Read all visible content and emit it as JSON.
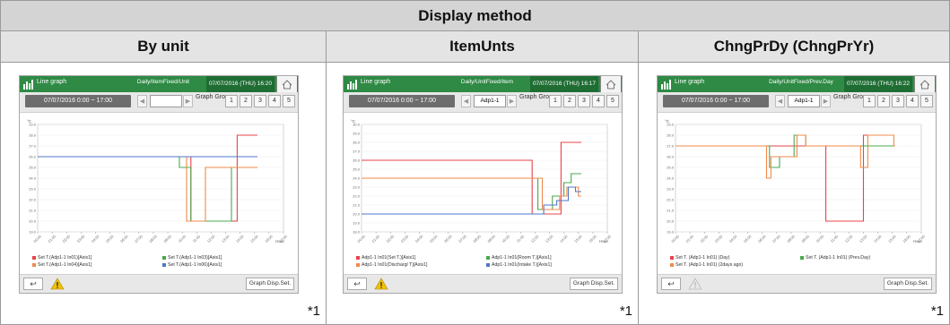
{
  "table_title": "Display method",
  "columns": [
    {
      "header": "By unit",
      "footnote": "*1",
      "screen": {
        "app_title": "Line graph",
        "mode": "Daily/ItemFixed/Unit",
        "datetime": "07/07/2016 (THU) 16:20",
        "range": "07/07/2016 0:00 ~ 17:00",
        "selected_unit": "",
        "graph_group_label": "Graph Group",
        "groups": [
          "1",
          "2",
          "3",
          "4",
          "5"
        ],
        "graph_disp_set": "Graph Disp.Set.",
        "warning_active": true,
        "legend": [
          {
            "label": "Set T.(Adp1-1 In01)[Axis1]",
            "color": "#e8434a"
          },
          {
            "label": "Set T.(Adp1-1 In03)[Axis1]",
            "color": "#4aa84e"
          },
          {
            "label": "Set T.(Adp1-1 In04)[Axis1]",
            "color": "#f08a4b"
          },
          {
            "label": "Set T.(Adp1-1 In06)[Axis1]",
            "color": "#4f77c7"
          }
        ]
      }
    },
    {
      "header": "ItemUnts",
      "footnote": "*1",
      "screen": {
        "app_title": "Line graph",
        "mode": "Daily/UnitFixed/Item",
        "datetime": "07/07/2016 (THU) 16:17",
        "range": "07/07/2016 0:00 ~ 17:00",
        "selected_unit": "Adp1-1",
        "graph_group_label": "Graph Group",
        "groups": [
          "1",
          "2",
          "3",
          "4",
          "5"
        ],
        "graph_disp_set": "Graph Disp.Set.",
        "warning_active": true,
        "legend": [
          {
            "label": "Adp1-1 In01(Set T.)[Axis1]",
            "color": "#e8434a"
          },
          {
            "label": "Adp1-1 In01(Room T.)[Axis1]",
            "color": "#4aa84e"
          },
          {
            "label": "Adp1-1 In01(Dischargl T)[Axis1]",
            "color": "#f08a4b"
          },
          {
            "label": "Adp1-1 In01(Intake T.)[Axis1]",
            "color": "#4f77c7"
          }
        ]
      }
    },
    {
      "header": "ChngPrDy (ChngPrYr)",
      "footnote": "*1",
      "screen": {
        "app_title": "Line graph",
        "mode": "Daily/UnitFixed/Prev.Day",
        "datetime": "07/07/2016 (THU) 16:22",
        "range": "07/07/2016 0:00 ~ 17:00",
        "selected_unit": "Adp1-1",
        "graph_group_label": "Graph Group",
        "groups": [
          "1",
          "2",
          "3",
          "4",
          "5"
        ],
        "graph_disp_set": "Graph Disp.Set.",
        "warning_active": false,
        "legend": [
          {
            "label": "Set T. (Adp1-1 In01) (Day)",
            "color": "#e8434a"
          },
          {
            "label": "Set T. (Adp1-1 In01) (Prev.Day)",
            "color": "#4aa84e"
          },
          {
            "label": "Set T. (Adp1-1 In01) (2days ago)",
            "color": "#f08a4b"
          }
        ]
      }
    }
  ],
  "chart_data": [
    {
      "type": "line",
      "ylabel": "°C",
      "ylim": [
        19,
        29
      ],
      "x": [
        "00:00",
        "01:00",
        "02:00",
        "03:00",
        "04:00",
        "05:00",
        "06:00",
        "07:00",
        "08:00",
        "09:00",
        "10:00",
        "11:00",
        "12:00",
        "13:00",
        "14:00",
        "15:00",
        "16:00",
        "17:00"
      ],
      "xlabel": "Hour",
      "series": [
        {
          "name": "Set T.(Adp1-1 In01)[Axis1]",
          "color": "#e8434a",
          "points": [
            [
              0,
              26
            ],
            [
              10.6,
              26
            ],
            [
              10.6,
              20
            ],
            [
              13.8,
              20
            ],
            [
              13.8,
              28
            ],
            [
              15.2,
              28
            ]
          ]
        },
        {
          "name": "Set T.(Adp1-1 In03)[Axis1]",
          "color": "#4aa84e",
          "points": [
            [
              0,
              26
            ],
            [
              9.8,
              26
            ],
            [
              9.8,
              25
            ],
            [
              10.6,
              25
            ],
            [
              10.6,
              20
            ],
            [
              13.4,
              20
            ],
            [
              13.4,
              25
            ],
            [
              15.2,
              25
            ]
          ]
        },
        {
          "name": "Set T.(Adp1-1 In04)[Axis1]",
          "color": "#f08a4b",
          "points": [
            [
              0,
              26
            ],
            [
              10.3,
              26
            ],
            [
              10.3,
              20
            ],
            [
              11.6,
              20
            ],
            [
              11.6,
              25
            ],
            [
              15.2,
              25
            ]
          ]
        },
        {
          "name": "Set T.(Adp1-1 In06)[Axis1]",
          "color": "#4f77c7",
          "points": [
            [
              0,
              26
            ],
            [
              15.2,
              26
            ]
          ]
        }
      ]
    },
    {
      "type": "line",
      "ylabel": "°C",
      "ylim": [
        18,
        30
      ],
      "x": [
        "00:00",
        "01:00",
        "02:00",
        "03:00",
        "04:00",
        "05:00",
        "06:00",
        "07:00",
        "08:00",
        "09:00",
        "10:00",
        "11:00",
        "12:00",
        "13:00",
        "14:00",
        "15:00",
        "16:00",
        "17:00"
      ],
      "xlabel": "Hour",
      "series": [
        {
          "name": "Adp1-1 In01(Set T.)[Axis1]",
          "color": "#e8434a",
          "points": [
            [
              0,
              26
            ],
            [
              11.8,
              26
            ],
            [
              11.8,
              20
            ],
            [
              13.8,
              20
            ],
            [
              13.8,
              28
            ],
            [
              15.2,
              28
            ]
          ]
        },
        {
          "name": "Adp1-1 In01(Room T.)[Axis1]",
          "color": "#4aa84e",
          "points": [
            [
              0,
              24
            ],
            [
              12.2,
              24
            ],
            [
              12.2,
              20.5
            ],
            [
              13.2,
              20.5
            ],
            [
              13.2,
              22
            ],
            [
              14,
              22
            ],
            [
              14,
              23.5
            ],
            [
              14.5,
              23.5
            ],
            [
              14.5,
              24.5
            ],
            [
              15.2,
              24.5
            ]
          ]
        },
        {
          "name": "Adp1-1 In01(Dischargl T)[Axis1]",
          "color": "#f08a4b",
          "points": [
            [
              0,
              24
            ],
            [
              12.5,
              24
            ],
            [
              12.5,
              20.5
            ],
            [
              13.7,
              20.5
            ],
            [
              13.7,
              22
            ],
            [
              14.2,
              22
            ],
            [
              14.2,
              23
            ],
            [
              15,
              23
            ],
            [
              15,
              22
            ],
            [
              15.2,
              22
            ]
          ]
        },
        {
          "name": "Adp1-1 In01(Intake T.)[Axis1]",
          "color": "#4f77c7",
          "points": [
            [
              0,
              20
            ],
            [
              12.6,
              20
            ],
            [
              12.6,
              21
            ],
            [
              13.5,
              21
            ],
            [
              13.5,
              21.5
            ],
            [
              14.3,
              21.5
            ],
            [
              14.3,
              23
            ],
            [
              14.8,
              23
            ],
            [
              14.8,
              22.5
            ],
            [
              15.2,
              22.5
            ]
          ]
        }
      ]
    },
    {
      "type": "line",
      "ylabel": "°C",
      "ylim": [
        19,
        29
      ],
      "x": [
        "00:00",
        "01:00",
        "02:00",
        "03:00",
        "04:00",
        "05:00",
        "06:00",
        "07:00",
        "08:00",
        "09:00",
        "10:00",
        "11:00",
        "12:00",
        "13:00",
        "14:00",
        "15:00",
        "16:00",
        "17:00"
      ],
      "xlabel": "Hour",
      "series": [
        {
          "name": "Set T. (Adp1-1 In01) (Day)",
          "color": "#e8434a",
          "points": [
            [
              0,
              27
            ],
            [
              10.4,
              27
            ],
            [
              10.4,
              20
            ],
            [
              13.0,
              20
            ],
            [
              13.0,
              28
            ],
            [
              15.0,
              28
            ]
          ]
        },
        {
          "name": "Set T. (Adp1-1 In01) (Prev.Day)",
          "color": "#4aa84e",
          "points": [
            [
              0,
              27
            ],
            [
              6.5,
              27
            ],
            [
              6.5,
              25
            ],
            [
              7.2,
              25
            ],
            [
              7.2,
              26
            ],
            [
              8.2,
              26
            ],
            [
              8.2,
              28
            ],
            [
              9.0,
              28
            ],
            [
              9.0,
              27
            ],
            [
              15.2,
              27
            ]
          ]
        },
        {
          "name": "Set T. (Adp1-1 In01) (2days ago)",
          "color": "#f08a4b",
          "points": [
            [
              0,
              27
            ],
            [
              6.3,
              27
            ],
            [
              6.3,
              24
            ],
            [
              6.6,
              24
            ],
            [
              6.6,
              26
            ],
            [
              8.4,
              26
            ],
            [
              8.4,
              28
            ],
            [
              9.0,
              28
            ],
            [
              9.0,
              27
            ],
            [
              12.8,
              27
            ],
            [
              12.8,
              25
            ],
            [
              13.3,
              25
            ],
            [
              13.3,
              28
            ],
            [
              15.1,
              28
            ],
            [
              15.1,
              27
            ],
            [
              15.2,
              27
            ]
          ]
        }
      ]
    }
  ]
}
